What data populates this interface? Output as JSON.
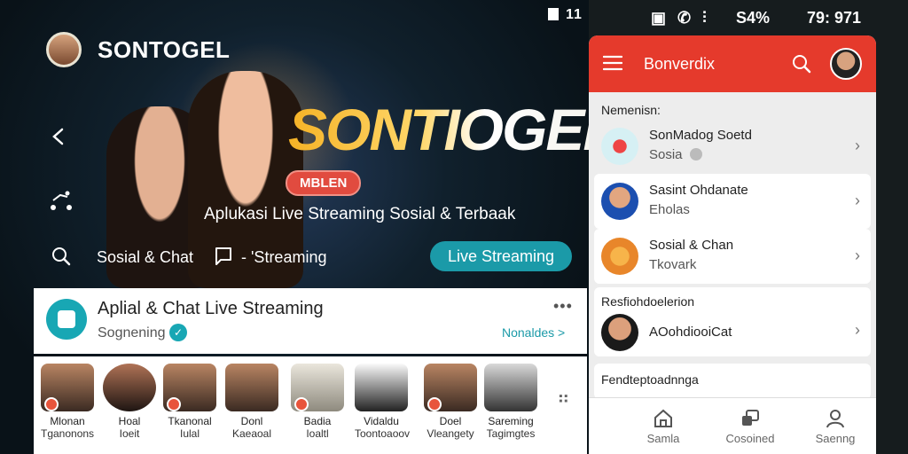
{
  "status": {
    "left_time": "11",
    "icons": "▣ ✆ ⫶",
    "battery": "S4%",
    "time": "79: 971"
  },
  "brand": {
    "name": "SONTOGEL"
  },
  "hero": {
    "title": "SONTIOGEL",
    "badge": "MBLEN",
    "subtitle": "Aplukasi Live Streaming Sosial & Terbaak"
  },
  "nav": {
    "item1": "Sosial & Chat",
    "item2": "- 'Streaming",
    "live_button": "Live Streaming"
  },
  "app_card": {
    "title": "Aplial & Chat Live Streaming",
    "subtitle": "Sognening",
    "link": "Nonaldes >"
  },
  "thumbs": [
    {
      "name1": "Mlonan",
      "name2": "Tganonons"
    },
    {
      "name1": "Hoal",
      "name2": "Ioeit"
    },
    {
      "name1": "Tkanonal",
      "name2": "Iulal"
    },
    {
      "name1": "Donl",
      "name2": "Kaeaoal"
    },
    {
      "name1": "Badia",
      "name2": "Ioaltl"
    },
    {
      "name1": "Vidaldu",
      "name2": "Toontoaoov"
    },
    {
      "name1": "Doel",
      "name2": "Vleangety"
    },
    {
      "name1": "Sareming",
      "name2": "Tagimgtes"
    }
  ],
  "panel": {
    "title": "Bonverdix",
    "section1": "Nemenisn:",
    "items": [
      {
        "title": "SonMadog Soetd",
        "sub": "Sosia"
      },
      {
        "title": "Sasint Ohdanate",
        "sub": "Eholas"
      },
      {
        "title": "Sosial & Chan",
        "sub": "Tkovark"
      }
    ],
    "section2": "Resfiohdoelerion",
    "item4": {
      "title": "AOohdiooiCat"
    },
    "section3": "Fendteptoadnnga",
    "bottom": [
      "Samla",
      "Cosoined",
      "Saenng"
    ]
  },
  "colors": {
    "accent_red": "#e53a2c",
    "teal": "#1b9aa8"
  }
}
